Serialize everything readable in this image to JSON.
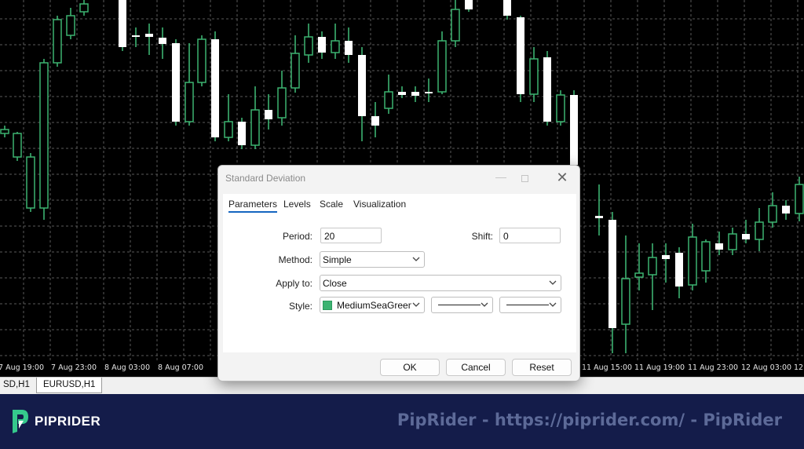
{
  "chart": {
    "background": "#000000",
    "grid_color": "#5a5a5a",
    "bull_color": "#000000",
    "bear_color": "#ffffff",
    "wick_color": "#3cb371",
    "candles": [
      [
        0,
        3,
        165,
        170,
        160,
        175
      ],
      [
        16,
        3,
        170,
        200,
        168,
        205
      ],
      [
        33,
        3,
        200,
        265,
        195,
        270
      ],
      [
        50,
        3,
        265,
        80,
        75,
        280
      ],
      [
        67,
        3,
        80,
        25,
        20,
        85
      ],
      [
        84,
        3,
        45,
        20,
        10,
        50
      ],
      [
        101,
        3,
        15,
        5,
        0,
        20
      ],
      [
        150,
        1,
        60,
        0,
        0,
        65
      ],
      [
        167,
        1,
        45,
        45,
        35,
        60
      ],
      [
        184,
        1,
        43,
        47,
        30,
        70
      ],
      [
        201,
        1,
        48,
        56,
        35,
        75
      ],
      [
        218,
        1,
        55,
        155,
        50,
        160
      ],
      [
        235,
        3,
        155,
        105,
        55,
        160
      ],
      [
        251,
        3,
        105,
        50,
        45,
        110
      ],
      [
        268,
        1,
        50,
        175,
        40,
        180
      ],
      [
        285,
        3,
        175,
        155,
        120,
        180
      ],
      [
        302,
        1,
        155,
        185,
        150,
        190
      ],
      [
        319,
        3,
        185,
        140,
        110,
        190
      ],
      [
        336,
        1,
        140,
        152,
        120,
        165
      ],
      [
        353,
        3,
        150,
        112,
        90,
        160
      ],
      [
        370,
        3,
        112,
        68,
        45,
        118
      ],
      [
        387,
        3,
        70,
        47,
        30,
        80
      ],
      [
        404,
        1,
        47,
        67,
        40,
        75
      ],
      [
        421,
        3,
        67,
        52,
        30,
        75
      ],
      [
        438,
        1,
        52,
        70,
        35,
        80
      ],
      [
        455,
        1,
        70,
        148,
        60,
        180
      ],
      [
        472,
        1,
        148,
        160,
        130,
        175
      ],
      [
        489,
        3,
        138,
        117,
        95,
        145
      ],
      [
        506,
        1,
        117,
        121,
        110,
        125
      ],
      [
        523,
        1,
        117,
        122,
        110,
        130
      ],
      [
        540,
        1,
        117,
        117,
        100,
        130
      ],
      [
        557,
        3,
        117,
        52,
        40,
        120
      ],
      [
        574,
        3,
        52,
        12,
        0,
        60
      ],
      [
        591,
        1,
        12,
        0,
        0,
        15
      ],
      [
        640,
        1,
        0,
        20,
        0,
        25
      ],
      [
        657,
        1,
        22,
        120,
        20,
        130
      ],
      [
        674,
        3,
        120,
        75,
        60,
        130
      ],
      [
        691,
        1,
        73,
        155,
        65,
        160
      ],
      [
        708,
        3,
        155,
        121,
        115,
        160
      ],
      [
        725,
        1,
        121,
        210,
        115,
        215
      ],
      [
        757,
        1,
        275,
        278,
        235,
        300
      ],
      [
        774,
        1,
        280,
        418,
        270,
        450
      ],
      [
        791,
        3,
        413,
        355,
        300,
        450
      ],
      [
        808,
        3,
        353,
        348,
        310,
        370
      ],
      [
        825,
        3,
        350,
        328,
        310,
        395
      ],
      [
        842,
        1,
        325,
        330,
        310,
        360
      ],
      [
        859,
        1,
        322,
        365,
        315,
        380
      ],
      [
        876,
        3,
        363,
        302,
        285,
        370
      ],
      [
        893,
        3,
        345,
        308,
        305,
        360
      ],
      [
        910,
        1,
        310,
        318,
        295,
        325
      ],
      [
        927,
        3,
        318,
        298,
        290,
        325
      ],
      [
        944,
        1,
        298,
        305,
        280,
        310
      ],
      [
        961,
        3,
        305,
        283,
        265,
        320
      ],
      [
        978,
        3,
        283,
        262,
        245,
        290
      ],
      [
        995,
        1,
        262,
        272,
        255,
        280
      ],
      [
        1012,
        3,
        272,
        235,
        225,
        282
      ]
    ]
  },
  "time_axis": {
    "labels": [
      {
        "text": "7 Aug 19:00"
      },
      {
        "text": "7 Aug 23:00"
      },
      {
        "text": "8 Aug 03:00"
      },
      {
        "text": "8 Aug 07:00"
      },
      {
        "text": "11 Aug 15:00"
      },
      {
        "text": "11 Aug 19:00"
      },
      {
        "text": "11 Aug 23:00"
      },
      {
        "text": "12 Aug 03:00"
      },
      {
        "text": "12"
      }
    ]
  },
  "tabs": [
    {
      "label": "SD,H1"
    },
    {
      "label": "EURUSD,H1"
    }
  ],
  "brand": {
    "name": "PIPRIDER",
    "watermark": "PipRider - https://piprider.com/ - PipRider"
  },
  "dialog": {
    "title": "Standard Deviation",
    "tabs": {
      "parameters": "Parameters",
      "levels": "Levels",
      "scale": "Scale",
      "visualization": "Visualization"
    },
    "fields": {
      "period_label": "Period:",
      "period_value": "20",
      "shift_label": "Shift:",
      "shift_value": "0",
      "method_label": "Method:",
      "method_value": "Simple",
      "apply_label": "Apply to:",
      "apply_value": "Close",
      "style_label": "Style:",
      "style_color_name": "MediumSeaGreen",
      "style_color": "#3cb371"
    },
    "buttons": {
      "ok": "OK",
      "cancel": "Cancel",
      "reset": "Reset"
    }
  }
}
